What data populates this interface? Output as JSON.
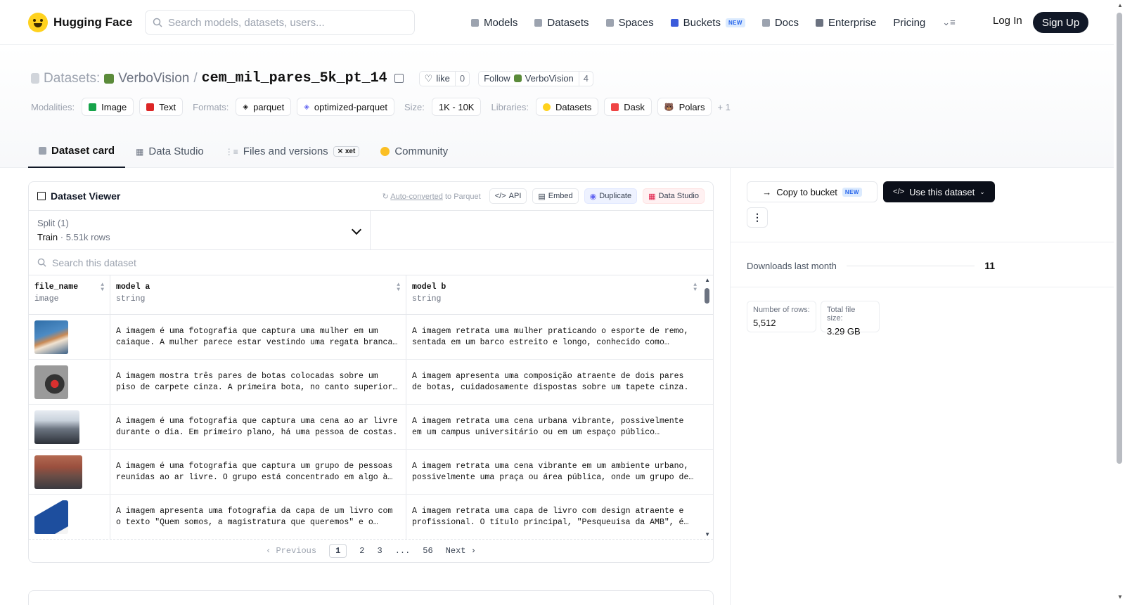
{
  "nav": {
    "brand": "Hugging Face",
    "search_placeholder": "Search models, datasets, users...",
    "links": [
      "Models",
      "Datasets",
      "Spaces",
      "Buckets",
      "Docs",
      "Enterprise",
      "Pricing"
    ],
    "new_badge": "NEW",
    "login": "Log In",
    "signup": "Sign Up"
  },
  "repo": {
    "label": "Datasets:",
    "owner": "VerboVision",
    "separator": "/",
    "name": "cem_mil_pares_5k_pt_14",
    "like_label": "like",
    "like_count": "0",
    "follow_label": "Follow",
    "follow_owner": "VerboVision",
    "follow_count": "4"
  },
  "meta": {
    "modalities_label": "Modalities:",
    "modalities": [
      "Image",
      "Text"
    ],
    "formats_label": "Formats:",
    "formats": [
      "parquet",
      "optimized-parquet"
    ],
    "size_label": "Size:",
    "size": "1K - 10K",
    "libraries_label": "Libraries:",
    "libraries": [
      "Datasets",
      "Dask",
      "Polars"
    ],
    "more": "+ 1"
  },
  "tabs": [
    "Dataset card",
    "Data Studio",
    "Files and versions",
    "Community"
  ],
  "xet_badge": "xet",
  "viewer": {
    "title": "Dataset Viewer",
    "auto_converted": "Auto-converted",
    "to_parquet": " to Parquet",
    "api": "API",
    "embed": "Embed",
    "duplicate": "Duplicate",
    "data_studio": "Data Studio",
    "split_label": "Split (1)",
    "split_value": "Train",
    "split_rows": "5.51k rows",
    "search_placeholder": "Search this dataset",
    "columns": [
      {
        "name": "file_name",
        "type": "image"
      },
      {
        "name": "model a",
        "type": "string"
      },
      {
        "name": "model b",
        "type": "string"
      }
    ],
    "rows": [
      {
        "a": "A imagem é uma fotografia que captura uma mulher em um caiaque. A mulher parece estar vestindo uma regata branca e está remando com calma.",
        "b": "A imagem retrata uma mulher praticando o esporte de remo, sentada em um barco estreito e longo, conhecido como skiff."
      },
      {
        "a": "A imagem mostra três pares de botas colocadas sobre um piso de carpete cinza. A primeira bota, no canto superior esquerdo, é preta.",
        "b": "A imagem apresenta uma composição atraente de dois pares de botas, cuidadosamente dispostas sobre um tapete cinza."
      },
      {
        "a": "A imagem é uma fotografia que captura uma cena ao ar livre durante o dia. Em primeiro plano, há uma pessoa de costas.",
        "b": "A imagem retrata uma cena urbana vibrante, possivelmente em um campus universitário ou em um espaço público movimentado."
      },
      {
        "a": "A imagem é uma fotografia que captura um grupo de pessoas reunidas ao ar livre. O grupo está concentrado em algo à frente.",
        "b": "A imagem retrata uma cena vibrante em um ambiente urbano, possivelmente uma praça ou área pública, onde um grupo de pessoas se reúne."
      },
      {
        "a": "A imagem apresenta uma fotografia da capa de um livro com o texto \"Quem somos, a magistratura que queremos\" e o logotipo.",
        "b": "A imagem retrata uma capa de livro com design atraente e profissional. O título principal, \"Pesqueuisa da AMB\", é destacado."
      }
    ],
    "pager": {
      "previous": "Previous",
      "pages": [
        "1",
        "2",
        "3",
        "...",
        "56"
      ],
      "next": "Next"
    }
  },
  "sidebar": {
    "copy_to_bucket": "Copy to bucket",
    "new_badge": "NEW",
    "use_dataset": "Use this dataset",
    "downloads_label": "Downloads last month",
    "downloads_value": "11",
    "rows_label": "Number of rows:",
    "rows_value": "5,512",
    "size_label": "Total file size:",
    "size_value": "3.29 GB"
  },
  "colors": {
    "accent_dark": "#0b0f19",
    "new_badge": "#2563eb",
    "brand": "#ffd21e"
  }
}
